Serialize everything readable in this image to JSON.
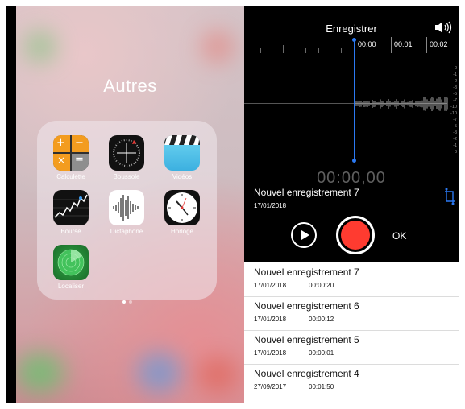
{
  "home": {
    "folder_title": "Autres",
    "apps": [
      {
        "label": "Calculette",
        "icon": "calculator-icon"
      },
      {
        "label": "Boussole",
        "icon": "compass-icon"
      },
      {
        "label": "Vidéos",
        "icon": "clapperboard-icon"
      },
      {
        "label": "Bourse",
        "icon": "stocks-icon"
      },
      {
        "label": "Dictaphone",
        "icon": "waveform-icon"
      },
      {
        "label": "Horloge",
        "icon": "clock-icon"
      },
      {
        "label": "Localiser",
        "icon": "radar-icon"
      }
    ],
    "page_count": 2,
    "current_page": 1
  },
  "recorder": {
    "title": "Enregistrer",
    "ruler_times": [
      "00:00",
      "00:01",
      "00:02"
    ],
    "scale_labels": [
      "0",
      "-1",
      "-2",
      "-3",
      "-5",
      "-7",
      "-10",
      "-10",
      "-7",
      "-5",
      "-3",
      "-2",
      "-1",
      "0"
    ],
    "timer": "00:00,00",
    "current": {
      "name": "Nouvel enregistrement 7",
      "date": "17/01/2018"
    },
    "ok_label": "OK",
    "accent_color": "#2b79f2",
    "record_color": "#ff3b30"
  },
  "recordings": [
    {
      "name": "Nouvel enregistrement 7",
      "date": "17/01/2018",
      "duration": "00:00:20"
    },
    {
      "name": "Nouvel enregistrement 6",
      "date": "17/01/2018",
      "duration": "00:00:12"
    },
    {
      "name": "Nouvel enregistrement 5",
      "date": "17/01/2018",
      "duration": "00:00:01"
    },
    {
      "name": "Nouvel enregistrement 4",
      "date": "27/09/2017",
      "duration": "00:01:50"
    }
  ]
}
